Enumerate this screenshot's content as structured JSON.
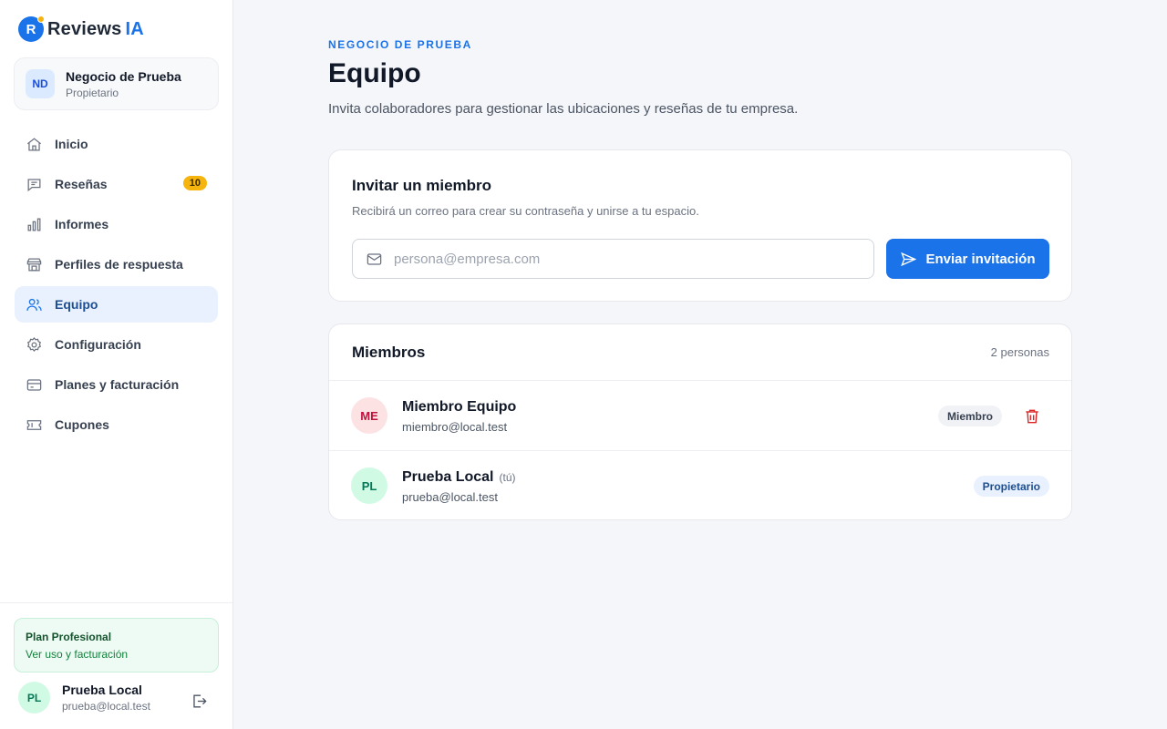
{
  "app": {
    "logo_letter": "R",
    "name_main": "Reviews",
    "name_accent": "IA"
  },
  "business": {
    "initials": "ND",
    "name": "Negocio de Prueba",
    "role": "Propietario"
  },
  "nav": {
    "items": [
      {
        "label": "Inicio",
        "icon": "home-icon"
      },
      {
        "label": "Reseñas",
        "icon": "message-icon",
        "badge": "10"
      },
      {
        "label": "Informes",
        "icon": "bar-chart-icon"
      },
      {
        "label": "Perfiles de respuesta",
        "icon": "storefront-icon"
      },
      {
        "label": "Equipo",
        "icon": "users-icon",
        "active": true
      },
      {
        "label": "Configuración",
        "icon": "gear-icon"
      },
      {
        "label": "Planes y facturación",
        "icon": "credit-card-icon"
      },
      {
        "label": "Cupones",
        "icon": "ticket-icon"
      }
    ]
  },
  "plan": {
    "title": "Plan Profesional",
    "link": "Ver uso y facturación"
  },
  "user": {
    "initials": "PL",
    "name": "Prueba Local",
    "email": "prueba@local.test"
  },
  "page": {
    "eyebrow": "NEGOCIO DE PRUEBA",
    "title": "Equipo",
    "subtitle": "Invita colaboradores para gestionar las ubicaciones y reseñas de tu empresa."
  },
  "invite": {
    "title": "Invitar un miembro",
    "description": "Recibirá un correo para crear su contraseña y unirse a tu espacio.",
    "email_placeholder": "persona@empresa.com",
    "email_value": "",
    "send_label": "Enviar invitación"
  },
  "members": {
    "title": "Miembros",
    "count": "2 personas",
    "list": [
      {
        "initials": "ME",
        "name": "Miembro Equipo",
        "you": "",
        "email": "miembro@local.test",
        "role": "Miembro"
      },
      {
        "initials": "PL",
        "name": "Prueba Local",
        "you": "(tú)",
        "email": "prueba@local.test",
        "role": "Propietario"
      }
    ]
  },
  "colors": {
    "accent": "#1a73e8",
    "badge": "#f6b40e",
    "danger": "#dc2626",
    "plan_bg": "#eefbf4"
  }
}
